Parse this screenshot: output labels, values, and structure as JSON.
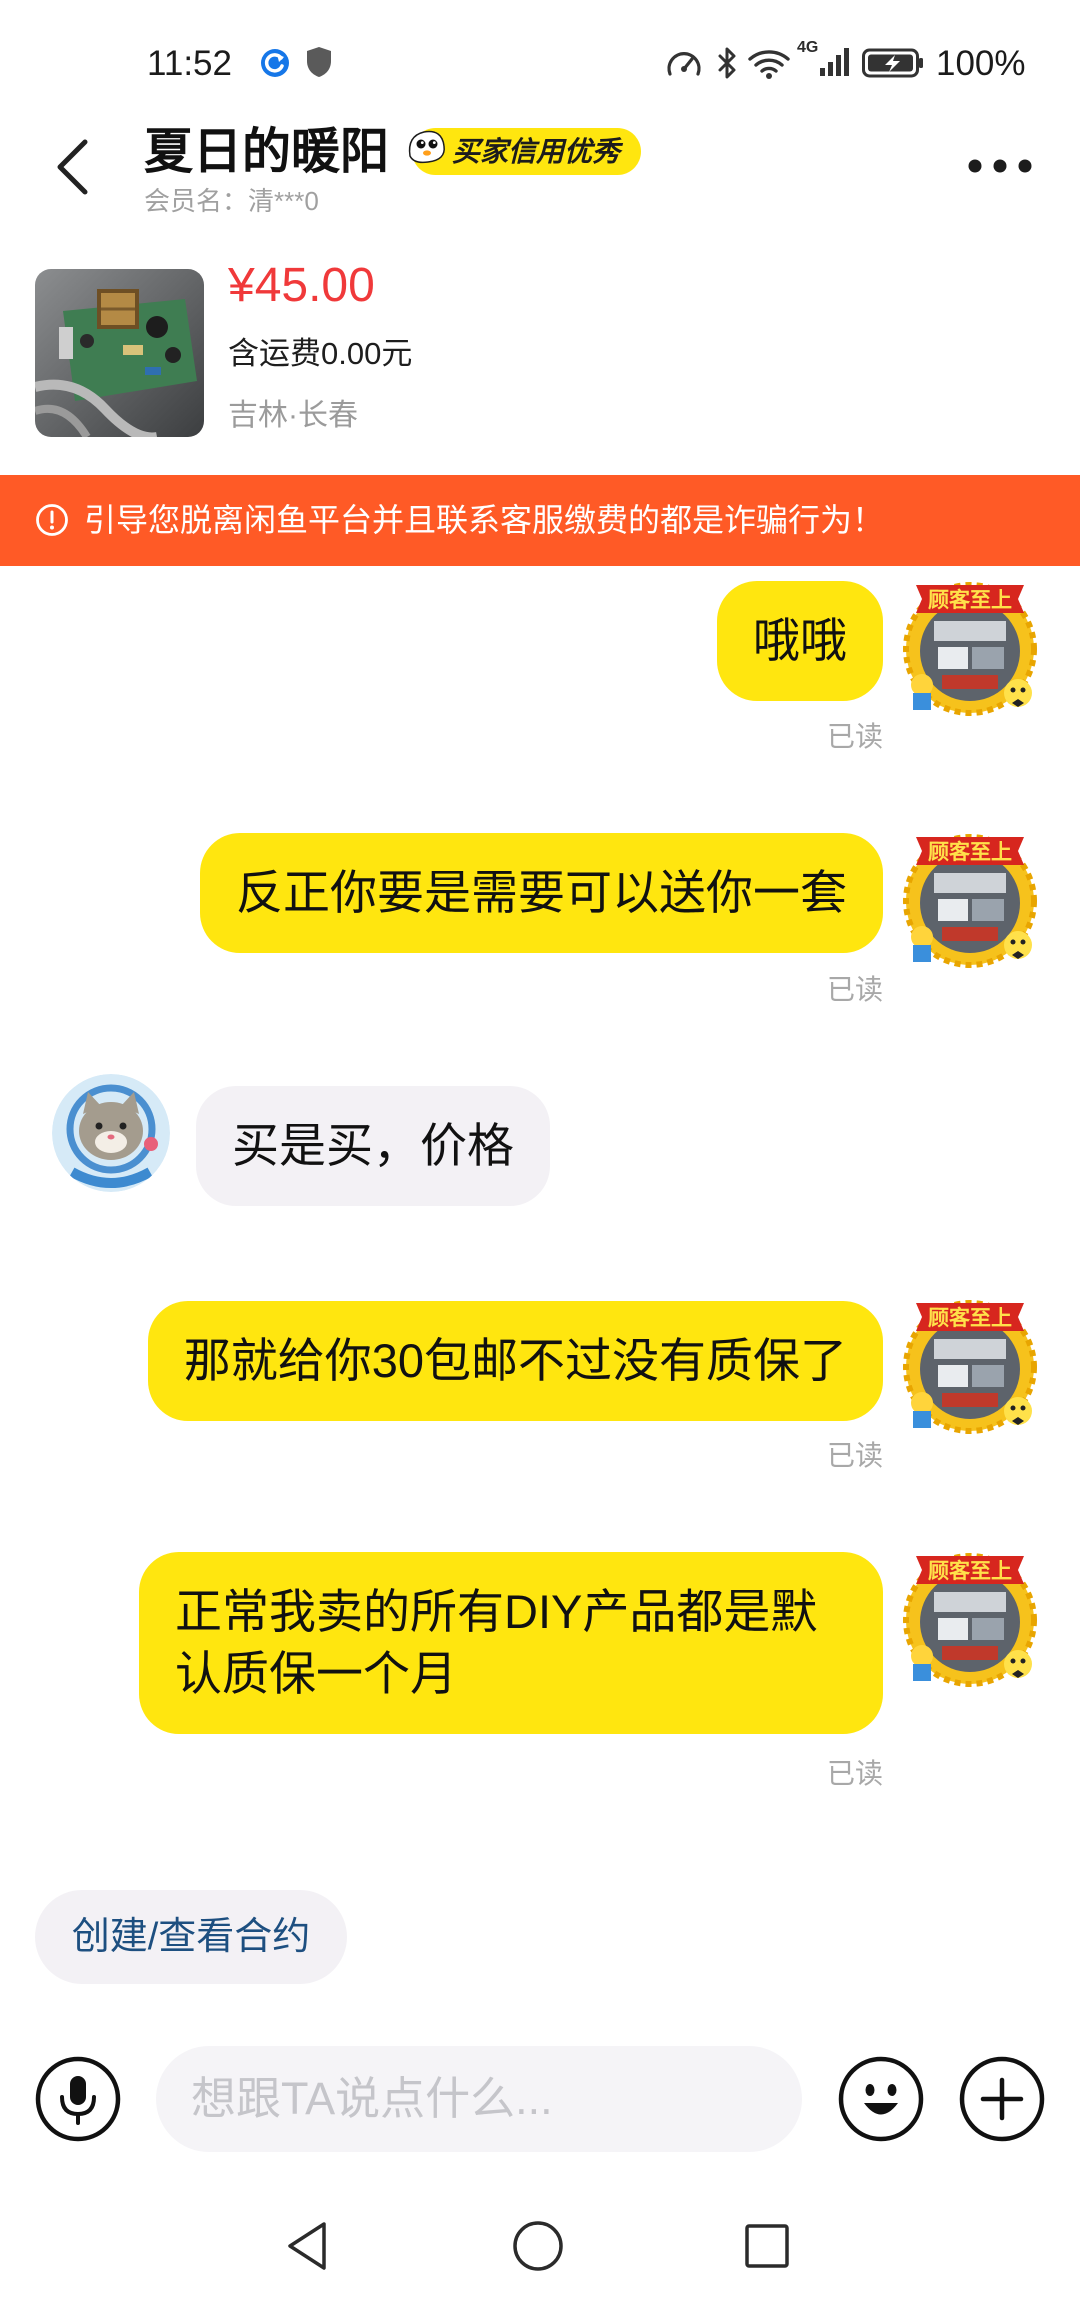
{
  "status_bar": {
    "time": "11:52",
    "network": "4G",
    "battery": "100%"
  },
  "header": {
    "title": "夏日的暖阳",
    "badge": "买家信用优秀",
    "member": "会员名：清***0"
  },
  "product": {
    "price": "¥45.00",
    "shipping": "含运费0.00元",
    "location": "吉林·长春"
  },
  "warning": {
    "text": "引导您脱离闲鱼平台并且联系客服缴费的都是诈骗行为！"
  },
  "chat": {
    "seller_avatar_text": "顾客至上",
    "messages": [
      {
        "from_me": true,
        "text": "哦哦",
        "status": "已读"
      },
      {
        "from_me": true,
        "text": "反正你要是需要可以送你一套",
        "status": "已读"
      },
      {
        "from_me": false,
        "text": "买是买，价格"
      },
      {
        "from_me": true,
        "text": "那就给你30包邮不过没有质保了",
        "status": "已读"
      },
      {
        "from_me": true,
        "text": "正常我卖的所有DIY产品都是默认质保一个月",
        "status": "已读"
      }
    ]
  },
  "contract_button": {
    "label": "创建/查看合约"
  },
  "composer": {
    "placeholder": "想跟TA说点什么..."
  },
  "colors": {
    "accent_yellow": "#FFE60F",
    "warning_bg": "#FF5A26",
    "price_red": "#F0393A",
    "incoming_bubble": "#F3F1F5",
    "contract_text": "#1d4f80"
  },
  "icons": [
    "app-notification-icon",
    "shield-icon",
    "speedometer-icon",
    "bluetooth-icon",
    "wifi-icon",
    "signal-icon",
    "battery-charging-icon",
    "back-chevron-icon",
    "more-dots-icon",
    "credit-mascot-icon",
    "info-icon",
    "mic-icon",
    "emoji-icon",
    "plus-icon",
    "nav-back-icon",
    "nav-home-icon",
    "nav-recents-icon"
  ]
}
